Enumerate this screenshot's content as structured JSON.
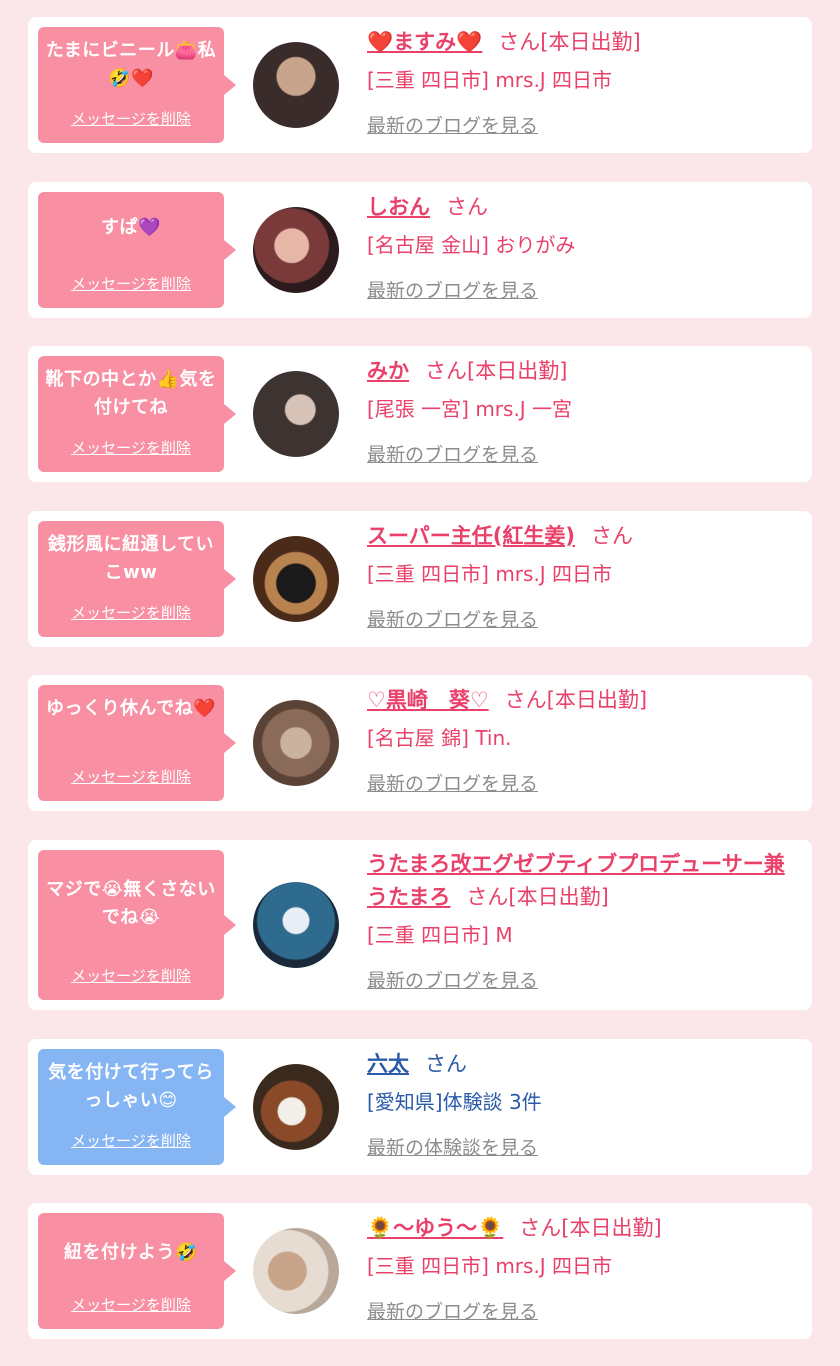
{
  "cards": [
    {
      "message": "たまにビニール👛私🤣❤️",
      "delete_label": "メッセージを削除",
      "name": "❤️ますみ❤️",
      "honorific": "さん[本日出勤]",
      "shop": "[三重 四日市] mrs.J 四日市",
      "blog_link": "最新のブログを見る",
      "bubble_color": "#f98fa2"
    },
    {
      "message": "すぱ💜",
      "delete_label": "メッセージを削除",
      "name": "しおん",
      "honorific": "さん",
      "shop": "[名古屋 金山] おりがみ",
      "blog_link": "最新のブログを見る",
      "bubble_color": "#f98fa2"
    },
    {
      "message": "靴下の中とか👍気を付けてね",
      "delete_label": "メッセージを削除",
      "name": "みか",
      "honorific": "さん[本日出勤]",
      "shop": "[尾張 一宮] mrs.J 一宮",
      "blog_link": "最新のブログを見る",
      "bubble_color": "#f98fa2"
    },
    {
      "message": "銭形風に紐通していこww",
      "delete_label": "メッセージを削除",
      "name": "スーパー主任(紅生姜)",
      "honorific": "さん",
      "shop": "[三重 四日市] mrs.J 四日市",
      "blog_link": "最新のブログを見る",
      "bubble_color": "#f98fa2"
    },
    {
      "message": "ゆっくり休んでね❤️",
      "delete_label": "メッセージを削除",
      "name": "♡黒崎　葵♡",
      "honorific": "さん[本日出勤]",
      "shop": "[名古屋 錦] Tin.",
      "blog_link": "最新のブログを見る",
      "bubble_color": "#f98fa2"
    },
    {
      "message": "マジで😭無くさないでね😭",
      "delete_label": "メッセージを削除",
      "name": "うたまろ改エグゼブティブプロデューサー兼うたまろ",
      "honorific": "さん[本日出勤]",
      "shop": "[三重 四日市] M",
      "blog_link": "最新のブログを見る",
      "bubble_color": "#f98fa2"
    },
    {
      "message": "気を付けて行ってらっしゃい😊",
      "delete_label": "メッセージを削除",
      "name": "六太",
      "honorific": "さん",
      "shop": "[愛知県]体験談 3件",
      "blog_link": "最新の体験談を見る",
      "bubble_color": "#86b5f3"
    },
    {
      "message": "紐を付けよう🤣",
      "delete_label": "メッセージを削除",
      "name": "🌻～ゆう～🌻",
      "honorific": "さん[本日出勤]",
      "shop": "[三重 四日市] mrs.J 四日市",
      "blog_link": "最新のブログを見る",
      "bubble_color": "#f98fa2"
    }
  ]
}
